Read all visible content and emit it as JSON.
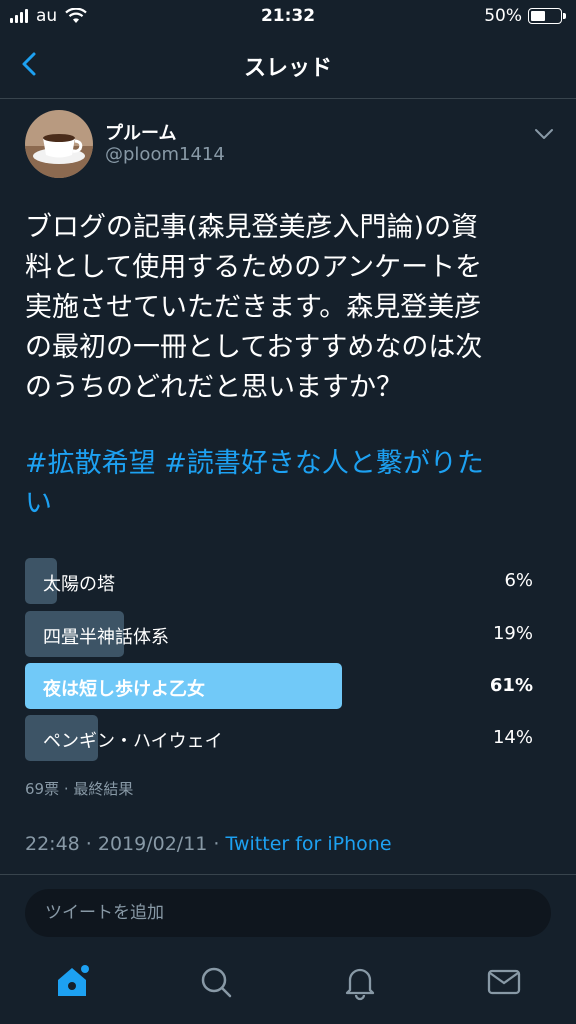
{
  "status_bar": {
    "carrier": "au",
    "time": "21:32",
    "battery_percent": "50%",
    "battery_level": 0.5
  },
  "nav": {
    "title": "スレッド",
    "back_icon": "chevron-left-icon"
  },
  "tweet": {
    "author_name": "プルーム",
    "author_handle": "@ploom1414",
    "text_lines": [
      "ブログの記事(森見登美彦入門論)の資",
      "料として使用するためのアンケートを",
      "実施させていただきます。森見登美彦",
      "の最初の一冊としておすすめなのは次",
      "のうちのどれだと思いますか？"
    ],
    "hashtag_1": "#拡散希望",
    "hashtag_2": "#読書好きな人と繋がりた",
    "hashtag_2_cont": "い",
    "timestamp": "22:48 · 2019/02/11 · ",
    "client": "Twitter for iPhone"
  },
  "poll": {
    "options": [
      {
        "label": "太陽の塔",
        "percent_text": "6%",
        "percent": 6,
        "winner": false
      },
      {
        "label": "四畳半神話体系",
        "percent_text": "19%",
        "percent": 19,
        "winner": false
      },
      {
        "label": "夜は短し歩けよ乙女",
        "percent_text": "61%",
        "percent": 61,
        "winner": true
      },
      {
        "label": "ペンギン・ハイウェイ",
        "percent_text": "14%",
        "percent": 14,
        "winner": false
      }
    ],
    "meta": "69票 · 最終結果"
  },
  "reply": {
    "placeholder": "ツイートを追加"
  },
  "tab_bar": {
    "items": [
      "home-icon",
      "search-icon",
      "notifications-icon",
      "messages-icon"
    ],
    "active": "home-icon"
  },
  "colors": {
    "background": "#15202b",
    "accent": "#1da1f2",
    "poll_bar": "#3d5466",
    "poll_winner": "#71c9f8",
    "secondary_text": "#8899a6"
  }
}
